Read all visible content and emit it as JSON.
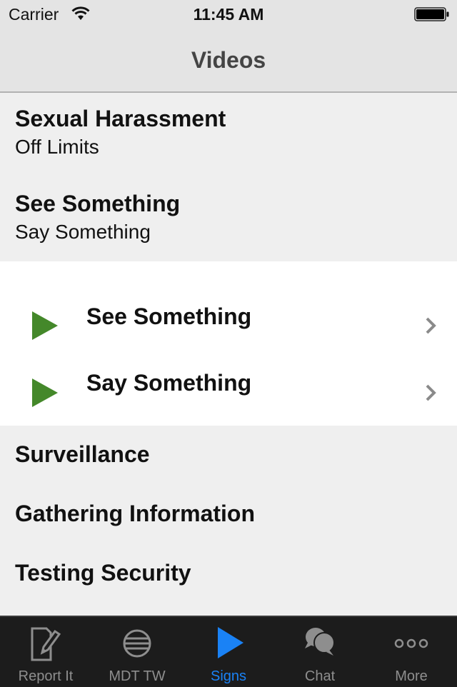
{
  "status_bar": {
    "carrier": "Carrier",
    "time": "11:45 AM",
    "icons": [
      "wifi-icon",
      "battery-icon"
    ]
  },
  "nav": {
    "title": "Videos"
  },
  "sections": {
    "top": [
      {
        "title": "Sexual Harassment",
        "subtitle": "Off Limits"
      },
      {
        "title": "See Something",
        "subtitle": "Say Something"
      }
    ],
    "videos": [
      {
        "label": "See Something",
        "icon": "play-icon",
        "accessory": "chevron-right-icon"
      },
      {
        "label": "Say Something",
        "icon": "play-icon",
        "accessory": "chevron-right-icon"
      }
    ],
    "bottom": [
      {
        "title": "Surveillance"
      },
      {
        "title": "Gathering Information"
      },
      {
        "title": "Testing Security"
      }
    ]
  },
  "tabbar": {
    "tabs": [
      {
        "label": "Report It",
        "icon": "report-edit-icon",
        "active": false
      },
      {
        "label": "MDT TW",
        "icon": "globe-stripes-icon",
        "active": false
      },
      {
        "label": "Signs",
        "icon": "play-icon",
        "active": true
      },
      {
        "label": "Chat",
        "icon": "chat-bubbles-icon",
        "active": false
      },
      {
        "label": "More",
        "icon": "more-dots-icon",
        "active": false
      }
    ]
  },
  "colors": {
    "accent_active_tab": "#1a82f5",
    "play_green": "#44882a",
    "tabbar_bg": "#1c1c1c",
    "inactive_tab": "#8e8e8e",
    "list_bg": "#efefef",
    "nav_bg": "#e4e4e4"
  }
}
